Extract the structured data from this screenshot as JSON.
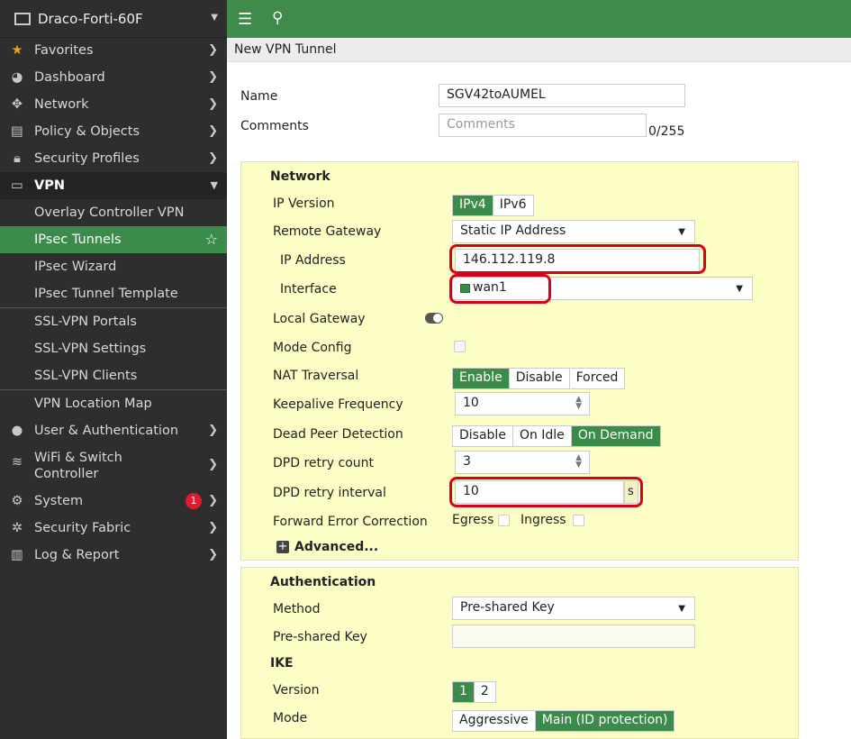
{
  "device_name": "Draco-Forti-60F",
  "sidebar": {
    "favorites": "Favorites",
    "dashboard": "Dashboard",
    "network": "Network",
    "policy": "Policy & Objects",
    "security_profiles": "Security Profiles",
    "vpn": "VPN",
    "vpn_items": [
      "Overlay Controller VPN",
      "IPsec Tunnels",
      "IPsec Wizard",
      "IPsec Tunnel Template",
      "SSL-VPN Portals",
      "SSL-VPN Settings",
      "SSL-VPN Clients",
      "VPN Location Map"
    ],
    "user_auth": "User & Authentication",
    "wifi_line1": "WiFi & Switch",
    "wifi_line2": "Controller",
    "system": "System",
    "system_badge": "1",
    "security_fabric": "Security Fabric",
    "log_report": "Log & Report"
  },
  "page_title": "New VPN Tunnel",
  "form": {
    "name_label": "Name",
    "name_value": "SGV42toAUMEL",
    "comments_label": "Comments",
    "comments_placeholder": "Comments",
    "comments_count": "0/255",
    "network_heading": "Network",
    "ip_version_label": "IP Version",
    "ip_version_options": [
      "IPv4",
      "IPv6"
    ],
    "remote_gateway_label": "Remote Gateway",
    "remote_gateway_value": "Static IP Address",
    "ip_address_label": "IP Address",
    "ip_address_value": "146.112.119.8",
    "interface_label": "Interface",
    "interface_value": "wan1",
    "local_gateway_label": "Local Gateway",
    "mode_config_label": "Mode Config",
    "nat_label": "NAT Traversal",
    "nat_options": [
      "Enable",
      "Disable",
      "Forced"
    ],
    "keepalive_label": "Keepalive Frequency",
    "keepalive_value": "10",
    "dpd_label": "Dead Peer Detection",
    "dpd_options": [
      "Disable",
      "On Idle",
      "On Demand"
    ],
    "dpd_retry_count_label": "DPD retry count",
    "dpd_retry_count_value": "3",
    "dpd_retry_interval_label": "DPD retry interval",
    "dpd_retry_interval_value": "10",
    "dpd_unit": "s",
    "fec_label": "Forward Error Correction",
    "egress": "Egress",
    "ingress": "Ingress",
    "advanced": "Advanced...",
    "auth_heading": "Authentication",
    "method_label": "Method",
    "method_value": "Pre-shared Key",
    "psk_label": "Pre-shared Key",
    "ike_heading": "IKE",
    "version_label": "Version",
    "version_options": [
      "1",
      "2"
    ],
    "mode_label": "Mode",
    "mode_options": [
      "Aggressive",
      "Main (ID protection)"
    ]
  },
  "colors": {
    "accent": "#3b8c4a",
    "highlight": "#d9001b",
    "panel": "#fdfdc6",
    "sidebar": "#2e2e2e",
    "badge": "#e01b2f"
  }
}
